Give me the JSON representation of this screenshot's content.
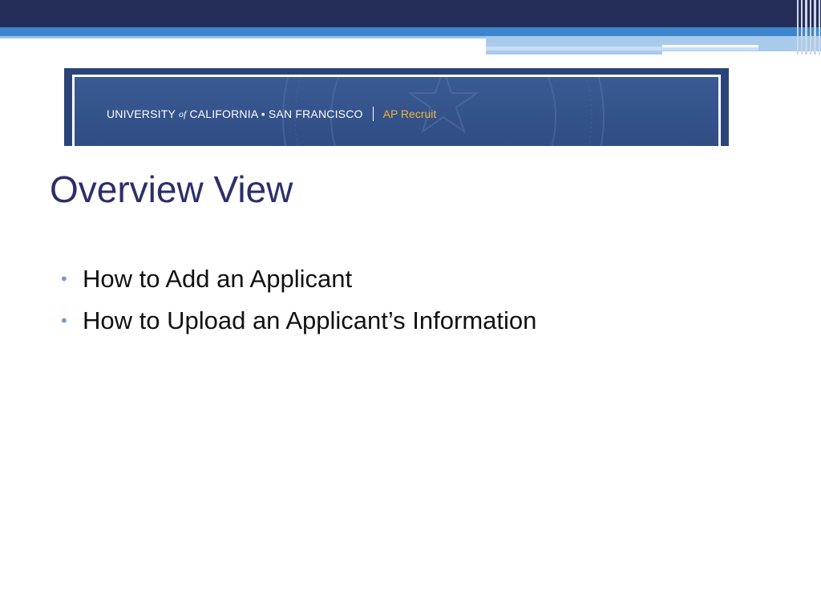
{
  "banner": {
    "university_part1": "UNIVERSITY",
    "university_of": "of",
    "university_part2": "CALIFORNIA • SAN FRANCISCO",
    "product": "AP Recruit",
    "seal_icon": "university-seal-watermark"
  },
  "slide": {
    "title": "Overview View",
    "bullets": [
      "How to Add an Applicant",
      "How to Upload an Applicant’s Information"
    ]
  },
  "colors": {
    "top_bar_dark": "#252d5a",
    "top_bar_blue": "#3d86cf",
    "banner_bg": "#2b4478",
    "title": "#2a2f6b",
    "product_accent": "#f2b43a",
    "bullet_dot": "#7a9ccc"
  }
}
